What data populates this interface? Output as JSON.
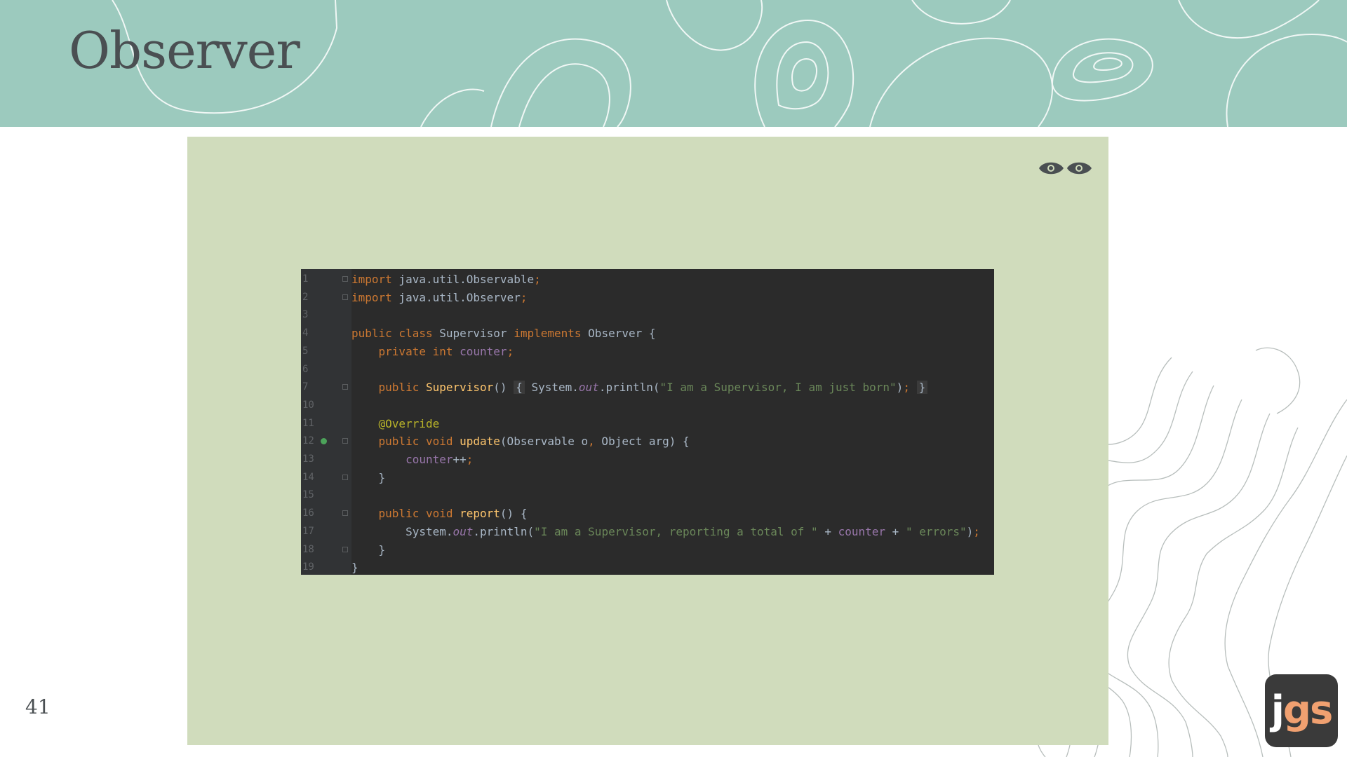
{
  "slide": {
    "title": "Observer",
    "number": "41",
    "logo": {
      "part1": "j",
      "part2": "gs"
    },
    "colors": {
      "header": "#9ccabe",
      "panel": "#d0dcbc",
      "code_bg": "#2b2b2b",
      "title": "#4a4f52"
    },
    "panel_icon": "eyes-icon"
  },
  "code": {
    "lines": [
      {
        "n": "1",
        "parts": [
          [
            "kw",
            "import"
          ],
          [
            "pl",
            " java.util.Observable"
          ],
          [
            "kw",
            ";"
          ]
        ]
      },
      {
        "n": "2",
        "parts": [
          [
            "kw",
            "import"
          ],
          [
            "pl",
            " java.util.Observer"
          ],
          [
            "kw",
            ";"
          ]
        ]
      },
      {
        "n": "3",
        "parts": []
      },
      {
        "n": "4",
        "parts": [
          [
            "kw",
            "public class "
          ],
          [
            "pl",
            "Supervisor "
          ],
          [
            "kw",
            "implements "
          ],
          [
            "pl",
            "Observer {"
          ]
        ]
      },
      {
        "n": "5",
        "parts": [
          [
            "pl",
            "    "
          ],
          [
            "kw",
            "private int "
          ],
          [
            "fld",
            "counter"
          ],
          [
            "kw",
            ";"
          ]
        ]
      },
      {
        "n": "6",
        "parts": []
      },
      {
        "n": "7",
        "parts": [
          [
            "pl",
            "    "
          ],
          [
            "kw",
            "public "
          ],
          [
            "fn",
            "Supervisor"
          ],
          [
            "pl",
            "() "
          ],
          [
            "folded",
            "{"
          ],
          [
            "pl",
            " System."
          ],
          [
            "it",
            "out"
          ],
          [
            "pl",
            ".println("
          ],
          [
            "st",
            "\"I am a Supervisor, I am just born\""
          ],
          [
            "pl",
            ")"
          ],
          [
            "kw",
            ";"
          ],
          [
            "pl",
            " "
          ],
          [
            "folded",
            "}"
          ]
        ]
      },
      {
        "n": "10",
        "parts": []
      },
      {
        "n": "11",
        "parts": [
          [
            "pl",
            "    "
          ],
          [
            "an",
            "@Override"
          ]
        ]
      },
      {
        "n": "12",
        "parts": [
          [
            "pl",
            "    "
          ],
          [
            "kw",
            "public void "
          ],
          [
            "fn",
            "update"
          ],
          [
            "pl",
            "(Observable o"
          ],
          [
            "kw",
            ","
          ],
          [
            "pl",
            " Object arg) {"
          ]
        ]
      },
      {
        "n": "13",
        "parts": [
          [
            "pl",
            "        "
          ],
          [
            "fld",
            "counter"
          ],
          [
            "pl",
            "++"
          ],
          [
            "kw",
            ";"
          ]
        ]
      },
      {
        "n": "14",
        "parts": [
          [
            "pl",
            "    }"
          ]
        ]
      },
      {
        "n": "15",
        "parts": []
      },
      {
        "n": "16",
        "parts": [
          [
            "pl",
            "    "
          ],
          [
            "kw",
            "public void "
          ],
          [
            "fn",
            "report"
          ],
          [
            "pl",
            "() {"
          ]
        ]
      },
      {
        "n": "17",
        "parts": [
          [
            "pl",
            "        System."
          ],
          [
            "it",
            "out"
          ],
          [
            "pl",
            ".println("
          ],
          [
            "st",
            "\"I am a Supervisor, reporting a total of \""
          ],
          [
            "pl",
            " + "
          ],
          [
            "fld",
            "counter"
          ],
          [
            "pl",
            " + "
          ],
          [
            "st",
            "\" errors\""
          ],
          [
            "pl",
            ")"
          ],
          [
            "kw",
            ";"
          ]
        ]
      },
      {
        "n": "18",
        "parts": [
          [
            "pl",
            "    }"
          ]
        ]
      },
      {
        "n": "19",
        "parts": [
          [
            "pl",
            "}"
          ]
        ]
      }
    ],
    "fold_lines": [
      "1",
      "2",
      "7",
      "12",
      "14",
      "16",
      "18"
    ],
    "override_marker_line": "12"
  }
}
